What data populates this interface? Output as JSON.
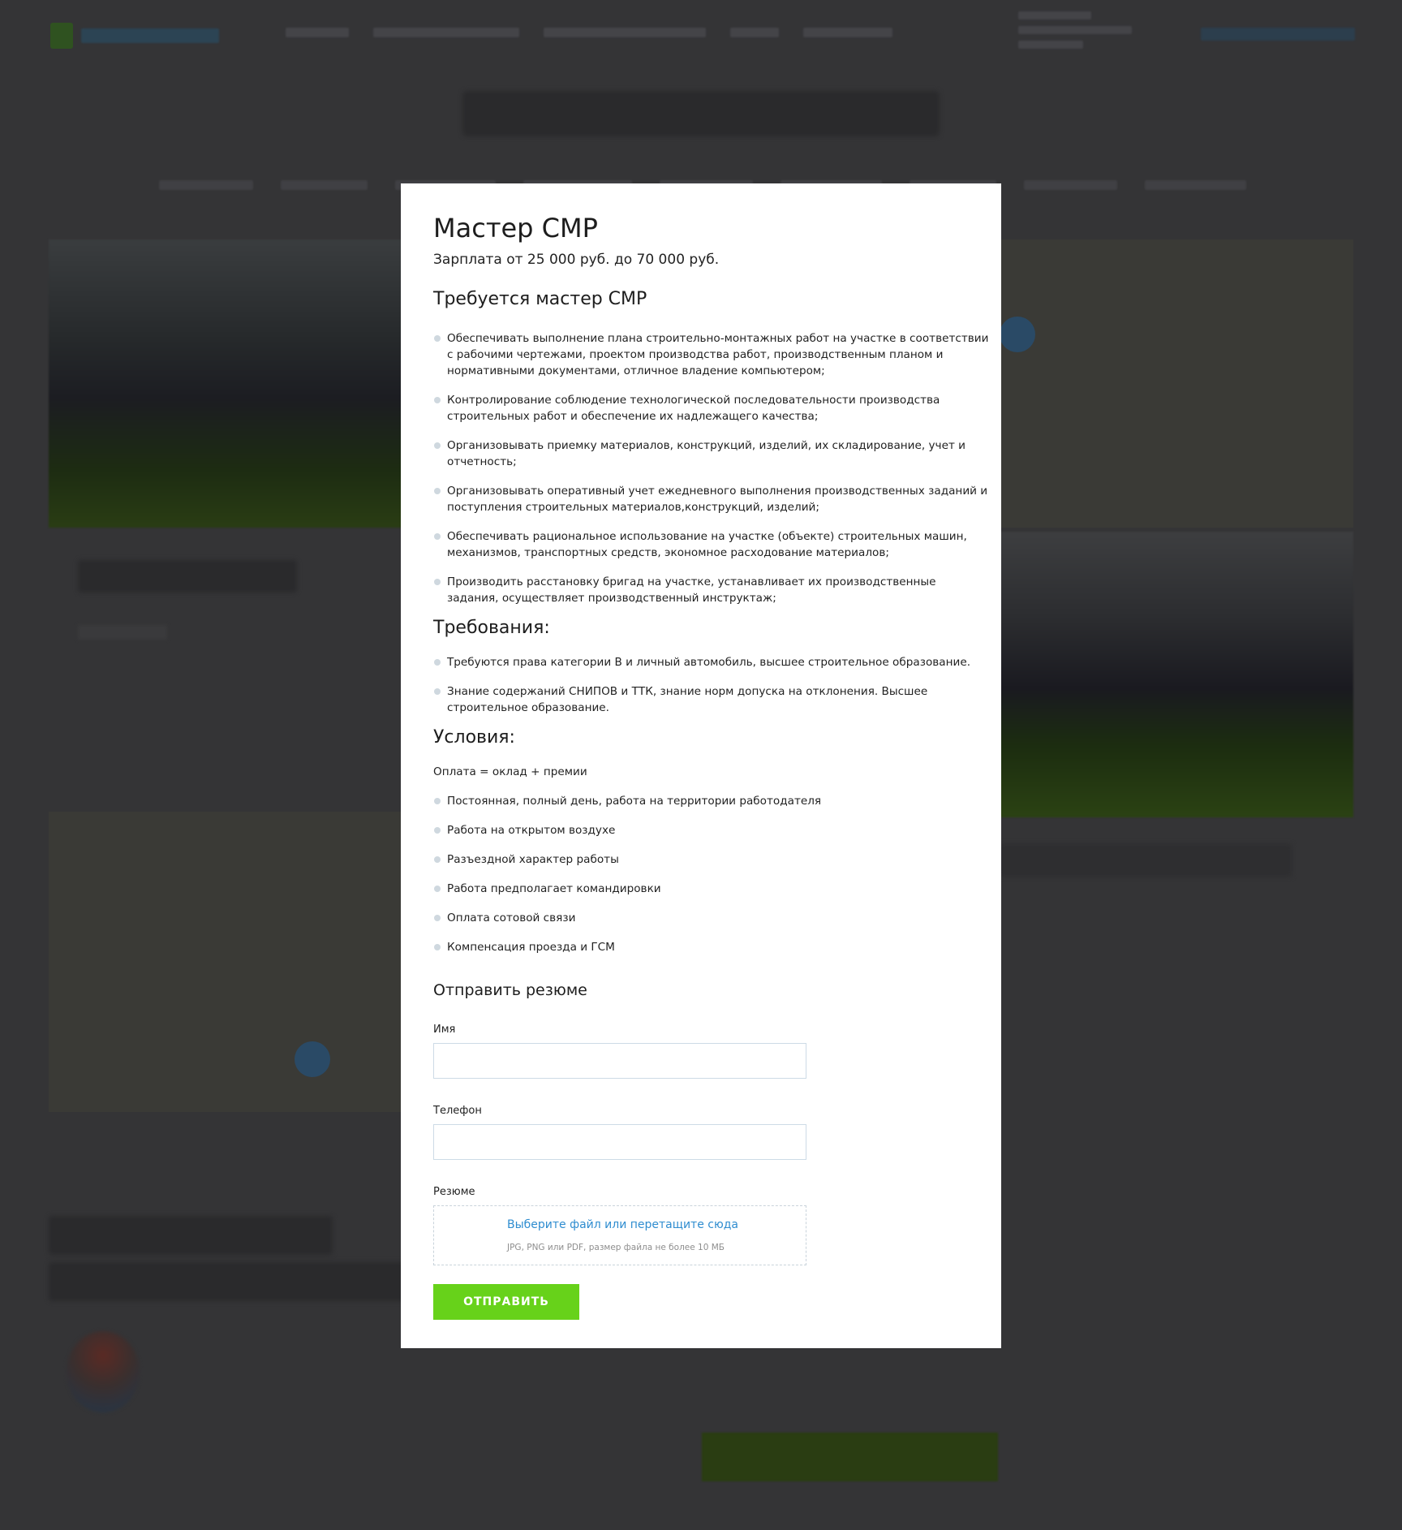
{
  "modal": {
    "title": "Мастер СМР",
    "salary": "Зарплата от 25 000 руб. до 70 000 руб.",
    "duties_heading": "Требуется мастер СМР",
    "duties": [
      "Обеспечивать выполнение плана строительно-монтажных работ на участке в соответствии с рабочими чертежами, проектом производства работ, производственным планом и нормативными документами, отличное владение компьютером;",
      "Контролирование соблюдение технологической последовательности производства строительных работ и обеспечение их надлежащего качества;",
      "Организовывать приемку материалов, конструкций, изделий, их складирование, учет и отчетность;",
      "Организовывать оперативный учет ежедневного выполнения производственных заданий и поступления строительных материалов,конструкций, изделий;",
      "Обеспечивать рациональное использование на участке (объекте) строительных машин, механизмов, транспортных средств, экономное расходование материалов;",
      "Производить расстановку бригад на участке, устанавливает их производственные задания, осуществляет производственный инструктаж;"
    ],
    "requirements_heading": "Требования:",
    "requirements": [
      "Требуются права категории В и личный автомобиль, высшее строительное образование.",
      "Знание содержаний СНИПОВ и ТТК, знание норм допуска на отклонения. Высшее строительное образование."
    ],
    "conditions_heading": "Условия:",
    "pay_note": "Оплата = оклад + премии",
    "conditions": [
      "Постоянная, полный день, работа на территории работодателя",
      "Работа на открытом воздухе",
      "Разъездной характер работы",
      "Работа предполагает командировки",
      "Оплата сотовой связи",
      "Компенсация проезда и ГСМ"
    ],
    "form": {
      "title": "Отправить резюме",
      "name_label": "Имя",
      "name_value": "",
      "phone_label": "Телефон",
      "phone_value": "",
      "resume_label": "Резюме",
      "upload_text": "Выберите файл или перетащите сюда",
      "upload_hint": "JPG, PNG или PDF, размер файла не более 10 МБ",
      "submit_label": "ОТПРАВИТЬ"
    }
  },
  "colors": {
    "overlay": "#343436",
    "accent_green": "#67d21a",
    "link_blue": "#2f8dd0",
    "bullet": "#cfd8df"
  },
  "icons": {
    "logo": "brand-logo-icon"
  }
}
